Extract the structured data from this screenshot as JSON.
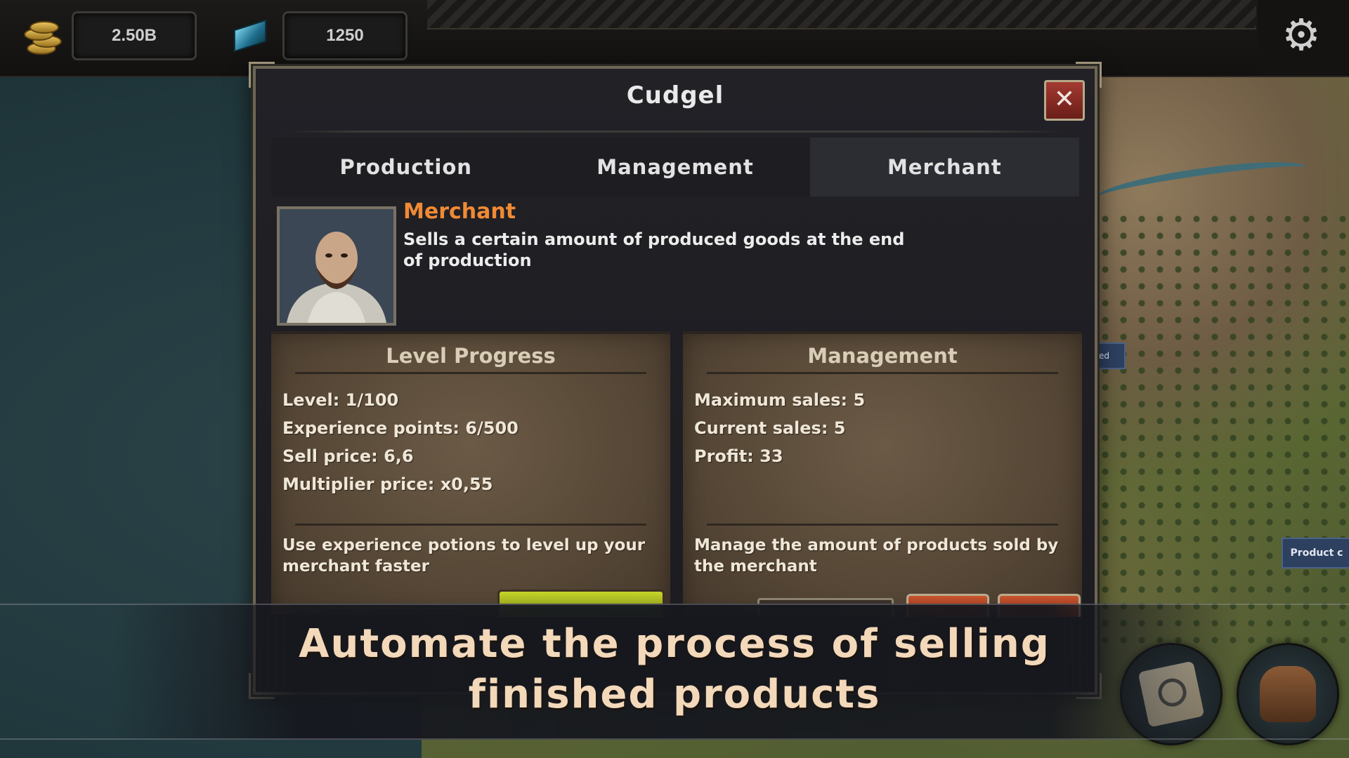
{
  "hud": {
    "gold_icon": "coin-stack-icon",
    "gold_value": "2.50B",
    "gem_icon": "crystal-icon",
    "gem_value": "1250",
    "settings_icon": "gear-icon"
  },
  "dialog": {
    "title": "Cudgel",
    "close_icon": "close-icon",
    "tabs": [
      {
        "label": "Production",
        "active": false
      },
      {
        "label": "Management",
        "active": false
      },
      {
        "label": "Merchant",
        "active": true
      }
    ],
    "merchant": {
      "title": "Merchant",
      "description": "Sells a certain amount of produced goods at the end of production"
    },
    "level_panel": {
      "title": "Level Progress",
      "stats": [
        "Level: 1/100",
        "Experience points: 6/500",
        "Sell price: 6,6",
        "Multiplier price: x0,55"
      ],
      "note": "Use experience potions to level up your merchant faster"
    },
    "management_panel": {
      "title": "Management",
      "stats": [
        "Maximum sales: 5",
        "Current sales: 5",
        "Profit: 33"
      ],
      "note": "Manage the amount of products sold by the merchant"
    }
  },
  "bottom_buttons": {
    "map_icon": "map-search-icon",
    "bag_icon": "backpack-icon",
    "side_label": "Product c",
    "side_label_2": "ed"
  },
  "banner": {
    "line1": "Automate the process of selling",
    "line2": "finished products"
  },
  "colors": {
    "accent": "#f08a34",
    "banner_text": "#f3d8ba",
    "close_button": "#a33a31",
    "progress_button": "#c7d62a"
  }
}
